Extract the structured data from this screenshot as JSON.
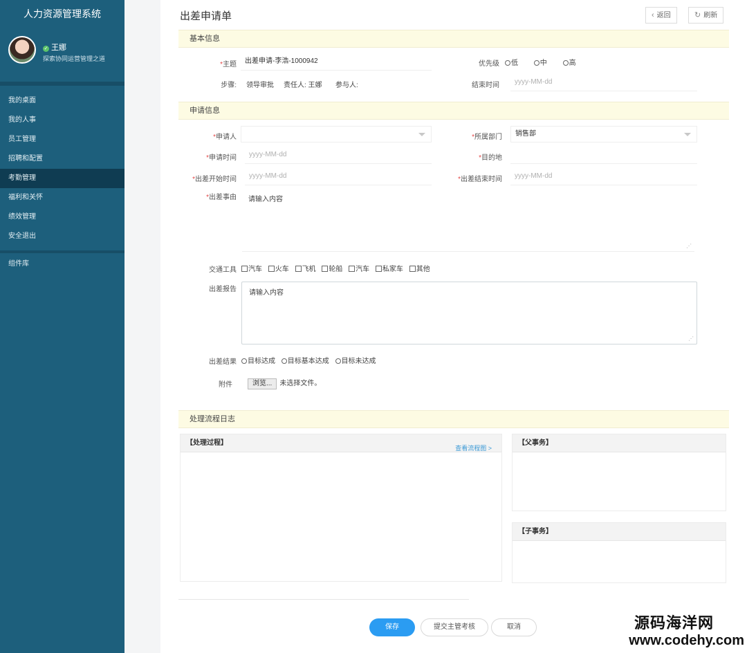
{
  "app": {
    "title": "人力资源管理系统"
  },
  "user": {
    "name": "王娜",
    "motto": "探索协同运营管理之道"
  },
  "sidebar": {
    "items": [
      {
        "label": "我的桌面"
      },
      {
        "label": "我的人事"
      },
      {
        "label": "员工管理"
      },
      {
        "label": "招聘和配置"
      },
      {
        "label": "考勤管理"
      },
      {
        "label": "福利和关怀"
      },
      {
        "label": "绩效管理"
      },
      {
        "label": "安全退出"
      }
    ],
    "extra": {
      "label": "组件库"
    }
  },
  "page": {
    "title": "出差申请单",
    "back_label": "返回",
    "refresh_label": "刷新"
  },
  "sections": {
    "basic": "基本信息",
    "apply": "申请信息",
    "log": "处理流程日志"
  },
  "basic": {
    "subject_label": "主题",
    "subject_value": "出差申请-李浩-1000942",
    "priority_label": "优先级",
    "priority_options": [
      "低",
      "中",
      "高"
    ],
    "steps_label": "步骤:",
    "steps_value": "领导审批",
    "owner_text": "责任人: 王娜",
    "participants_text": "参与人:",
    "end_time_label": "结束时间",
    "end_time_placeholder": "yyyy-MM-dd"
  },
  "apply": {
    "applicant_label": "申请人",
    "applicant_value": "",
    "dept_label": "所属部门",
    "dept_value": "销售部",
    "apply_time_label": "申请时间",
    "apply_time_placeholder": "yyyy-MM-dd",
    "destination_label": "目的地",
    "start_label": "出差开始时间",
    "start_placeholder": "yyyy-MM-dd",
    "end_label": "出差结束时间",
    "end_placeholder": "yyyy-MM-dd",
    "reason_label": "出差事由",
    "reason_placeholder": "请输入内容",
    "transport_label": "交通工具",
    "transport_options": [
      "汽车",
      "火车",
      "飞机",
      "轮船",
      "汽车",
      "私家车",
      "其他"
    ],
    "report_label": "出差报告",
    "report_placeholder": "请输入内容",
    "result_label": "出差结果",
    "result_options": [
      "目标达成",
      "目标基本达成",
      "目标未达成"
    ],
    "attach_label": "附件",
    "browse_label": "浏览...",
    "no_file_text": "未选择文件。"
  },
  "log": {
    "process_title": "【处理过程】",
    "view_chart_link": "查看流程图 >",
    "parent_title": "【父事务】",
    "child_title": "【子事务】"
  },
  "footer": {
    "save_label": "保存",
    "submit_label": "提交主管考核",
    "cancel_label": "取消"
  },
  "watermark": {
    "line1": "源码海洋网",
    "line2": "www.codehy.com"
  },
  "colors": {
    "sidebar": "#1d5f7c",
    "section_bg": "#fdfbe3",
    "primary": "#2b9cf2",
    "required": "#e34848"
  }
}
